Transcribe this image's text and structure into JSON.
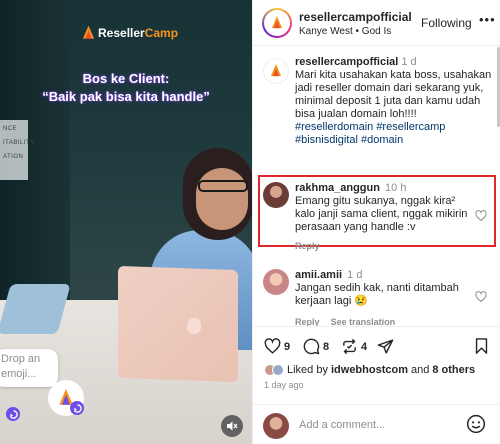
{
  "media": {
    "brand_main": "Reseller",
    "brand_accent": "Camp",
    "caption_line1": "Bos ke Client:",
    "caption_line2": "“Baik pak bisa kita handle”",
    "emoji_placeholder_line1": "Drop an",
    "emoji_placeholder_line2": "emoji...",
    "wall_text_1": "NCE",
    "wall_text_2": "ITABILITY",
    "wall_text_3": "ATION"
  },
  "header": {
    "username": "resellercampofficial",
    "music": "Kanye West • God Is",
    "follow_label": "Following",
    "more_label": "•••"
  },
  "post": {
    "username": "resellercampofficial",
    "time": "1 d",
    "text": "Mari kita usahakan kata boss, usahakan jadi reseller domain dari sekarang yuk, minimal deposit 1 juta dan kamu udah bisa jualan domain loh!!!!",
    "hashtags": "#resellerdomain #resellercamp #bisnisdigital #domain"
  },
  "comments": [
    {
      "username": "rakhma_anggun",
      "time": "10 h",
      "text": "Emang gitu sukanya, nggak kira² kalo janji sama client, nggak mikirin perasaan yang handle :v",
      "reply_label": "Reply"
    },
    {
      "username": "amii.amii",
      "time": "1 d",
      "text": "Jangan sedih kak, nanti ditambah kerjaan lagi 😢",
      "reply_label": "Reply",
      "translation_label": "See translation"
    }
  ],
  "actions": {
    "likes": "9",
    "comments": "8",
    "reposts": "4",
    "liked_prefix": "Liked by",
    "liked_user": "idwebhostcom",
    "liked_and": "and",
    "liked_others": "8 others",
    "time_ago": "1 day ago"
  },
  "composer": {
    "placeholder": "Add a comment..."
  },
  "colors": {
    "highlight": "#e0262b",
    "brand_accent": "#f7941d",
    "hashtag": "#00376b",
    "reel_badge": "#6e4ee6"
  },
  "icons": [
    "flame-logo-icon",
    "heart-icon",
    "comment-icon",
    "repost-icon",
    "share-icon",
    "bookmark-icon",
    "smiley-icon",
    "mute-icon",
    "reel-icon"
  ]
}
